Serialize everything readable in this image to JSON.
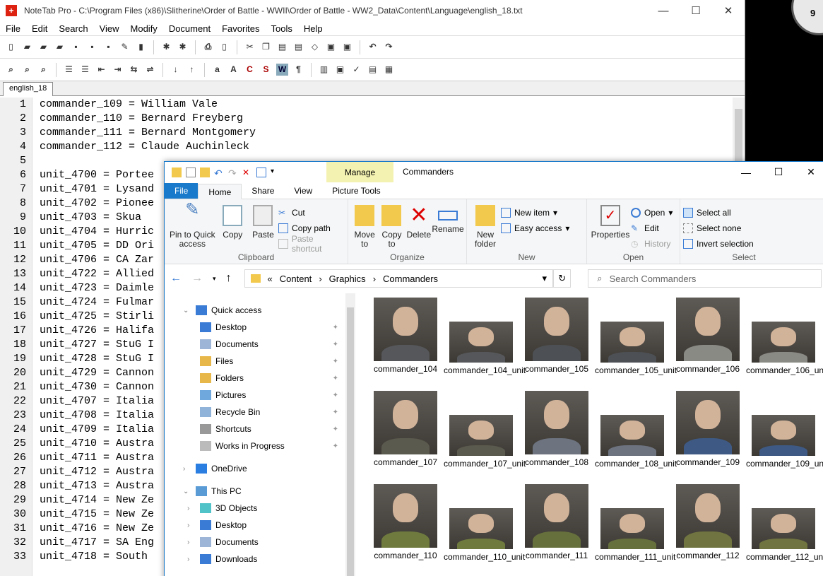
{
  "notetab": {
    "title": "NoteTab Pro  -  C:\\Program Files (x86)\\Slitherine\\Order of Battle - WWII\\Order of Battle - WW2_Data\\Content\\Language\\english_18.txt",
    "menu": [
      "File",
      "Edit",
      "Search",
      "View",
      "Modify",
      "Document",
      "Favorites",
      "Tools",
      "Help"
    ],
    "tab": "english_18",
    "lines": [
      "commander_109 = William Vale",
      "commander_110 = Bernard Freyberg",
      "commander_111 = Bernard Montgomery",
      "commander_112 = Claude Auchinleck",
      "",
      "unit_4700 = Portee",
      "unit_4701 = Lysand",
      "unit_4702 = Pionee",
      "unit_4703 = Skua",
      "unit_4704 = Hurric",
      "unit_4705 = DD Ori",
      "unit_4706 = CA Zar",
      "unit_4722 = Allied",
      "unit_4723 = Daimle",
      "unit_4724 = Fulmar",
      "unit_4725 = Stirli",
      "unit_4726 = Halifa",
      "unit_4727 = StuG I",
      "unit_4728 = StuG I",
      "unit_4729 = Cannon",
      "unit_4730 = Cannon",
      "unit_4707 = Italia",
      "unit_4708 = Italia",
      "unit_4709 = Italia",
      "unit_4710 = Austra",
      "unit_4711 = Austra",
      "unit_4712 = Austra",
      "unit_4713 = Austra",
      "unit_4714 = New Ze",
      "unit_4715 = New Ze",
      "unit_4716 = New Ze",
      "unit_4717 = SA Eng",
      "unit_4718 = South "
    ],
    "line_numbers": [
      "1",
      "2",
      "3",
      "4",
      "5",
      "6",
      "7",
      "8",
      "9",
      "10",
      "11",
      "12",
      "13",
      "14",
      "15",
      "16",
      "17",
      "18",
      "19",
      "20",
      "21",
      "22",
      "23",
      "24",
      "25",
      "26",
      "27",
      "28",
      "29",
      "30",
      "31",
      "32",
      "33"
    ]
  },
  "clock_digit": "9",
  "explorer": {
    "manage_tab": "Manage",
    "window_title": "Commanders",
    "ribbon_tabs": [
      "File",
      "Home",
      "Share",
      "View",
      "Picture Tools"
    ],
    "clipboard": {
      "pin": "Pin to Quick access",
      "copy": "Copy",
      "paste": "Paste",
      "cut": "Cut",
      "copy_path": "Copy path",
      "paste_shortcut": "Paste shortcut",
      "label": "Clipboard"
    },
    "organize": {
      "move_to": "Move to",
      "copy_to": "Copy to",
      "delete": "Delete",
      "rename": "Rename",
      "label": "Organize"
    },
    "new_group": {
      "new_folder": "New folder",
      "new_item": "New item",
      "easy_access": "Easy access",
      "label": "New"
    },
    "open_group": {
      "properties": "Properties",
      "open": "Open",
      "edit": "Edit",
      "history": "History",
      "label": "Open"
    },
    "select_group": {
      "select_all": "Select all",
      "select_none": "Select none",
      "invert": "Invert selection",
      "label": "Select"
    },
    "breadcrumb": [
      "Content",
      "Graphics",
      "Commanders"
    ],
    "search_placeholder": "Search Commanders",
    "nav": {
      "quick_access": "Quick access",
      "items": [
        "Desktop",
        "Documents",
        "Files",
        "Folders",
        "Pictures",
        "Recycle Bin",
        "Shortcuts",
        "Works in Progress"
      ],
      "onedrive": "OneDrive",
      "this_pc": "This PC",
      "pc_items": [
        "3D Objects",
        "Desktop",
        "Documents",
        "Downloads"
      ]
    },
    "files": [
      {
        "name": "commander_104",
        "uniform": "#55575a"
      },
      {
        "name": "commander_104_unit",
        "uniform": "#55575a"
      },
      {
        "name": "commander_105",
        "uniform": "#4d5054"
      },
      {
        "name": "commander_105_unit",
        "uniform": "#4d5054"
      },
      {
        "name": "commander_106",
        "uniform": "#8a8a84"
      },
      {
        "name": "commander_106_unit",
        "uniform": "#8a8a84"
      },
      {
        "name": "commander_107",
        "uniform": "#5b5a4e"
      },
      {
        "name": "commander_107_unit",
        "uniform": "#5b5a4e"
      },
      {
        "name": "commander_108",
        "uniform": "#6d7480"
      },
      {
        "name": "commander_108_unit",
        "uniform": "#6d7480"
      },
      {
        "name": "commander_109",
        "uniform": "#3e5a84"
      },
      {
        "name": "commander_109_unit",
        "uniform": "#3e5a84"
      },
      {
        "name": "commander_110",
        "uniform": "#6e7a3e"
      },
      {
        "name": "commander_110_unit",
        "uniform": "#6e7a3e"
      },
      {
        "name": "commander_111",
        "uniform": "#66703d"
      },
      {
        "name": "commander_111_unit",
        "uniform": "#66703d"
      },
      {
        "name": "commander_112",
        "uniform": "#6f7440"
      },
      {
        "name": "commander_112_unit",
        "uniform": "#6f7440"
      }
    ]
  }
}
